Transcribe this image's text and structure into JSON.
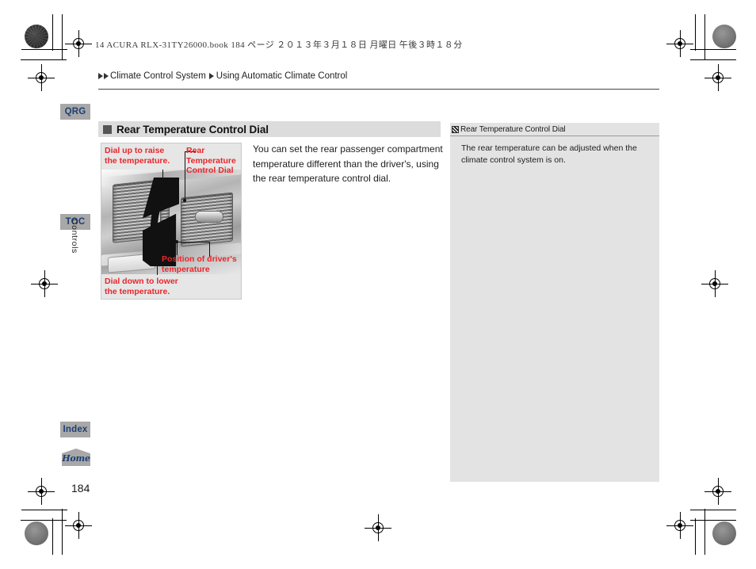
{
  "document": {
    "running_header": "14 ACURA RLX-31TY26000.book   184 ページ   ２０１３年３月１８日   月曜日   午後３時１８分",
    "page_number": "184"
  },
  "breadcrumb": {
    "first": "Climate Control System",
    "second": "Using Automatic Climate Control"
  },
  "sidebar": {
    "qrg_label": "QRG",
    "toc_label": "TOC",
    "index_label": "Index",
    "home_label": "Home",
    "chapter_label": "Controls"
  },
  "section": {
    "heading": "Rear Temperature Control Dial"
  },
  "figure": {
    "callout_up": "Dial up to raise\nthe temperature.",
    "callout_dial": "Rear\nTemperature\nControl Dial",
    "callout_position": "Position of driver's\ntemperature",
    "callout_down": "Dial down to lower\nthe temperature."
  },
  "main": {
    "body_text": "You can set the rear passenger compartment temperature different than the driver's, using the rear temperature control dial."
  },
  "note": {
    "title": "Rear Temperature Control Dial",
    "body": "The rear temperature can be adjusted when the climate control system is on."
  },
  "colors": {
    "callout_red": "#e8262b",
    "tab_blue": "#1c3f73",
    "tab_gray": "#a8a8a8",
    "heading_gray": "#dcdcdc",
    "note_gray": "#e3e3e3"
  }
}
